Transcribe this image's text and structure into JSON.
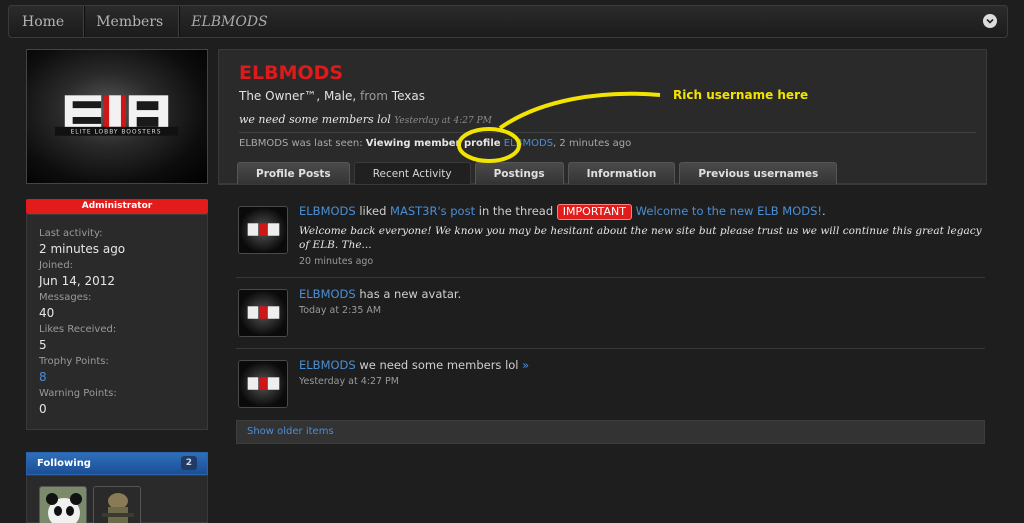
{
  "breadcrumb": {
    "items": [
      "Home",
      "Members",
      "ELBMODS"
    ]
  },
  "profile": {
    "username": "ELBMODS",
    "title_line": "The Owner™, Male,",
    "from_label": "from",
    "location": "Texas",
    "status": "we need some members lol",
    "status_time": "Yesterday at 4:27 PM",
    "last_seen_prefix": "ELBMODS was last seen:",
    "last_seen_action": "Viewing member profile",
    "last_seen_link": "ELBMODS",
    "last_seen_time": ", 2 minutes ago",
    "logo_text": "ELB",
    "logo_sub": "ELITE LOBBY BOOSTERS"
  },
  "sidebar": {
    "role": "Administrator",
    "stats": [
      {
        "label": "Last activity:",
        "value": "2 minutes ago"
      },
      {
        "label": "Joined:",
        "value": "Jun 14, 2012"
      },
      {
        "label": "Messages:",
        "value": "40"
      },
      {
        "label": "Likes Received:",
        "value": "5"
      },
      {
        "label": "Trophy Points:",
        "value": "8"
      },
      {
        "label": "Warning Points:",
        "value": "0"
      }
    ],
    "following_label": "Following",
    "following_count": "2"
  },
  "tabs": [
    "Profile Posts",
    "Recent Activity",
    "Postings",
    "Information",
    "Previous usernames"
  ],
  "activity": [
    {
      "user": "ELBMODS",
      "verb": "liked",
      "target": "MAST3R's post",
      "middle": "in the thread",
      "prefix_badge": "IMPORTANT",
      "thread": "Welcome to the new ELB MODS!",
      "end": ".",
      "excerpt": "Welcome back everyone! We know you may be hesitant about the new site but please trust us we will continue this great legacy of ELB. The...",
      "time": "20 minutes ago"
    },
    {
      "user": "ELBMODS",
      "verb": "has a new avatar.",
      "time": "Today at 2:35 AM"
    },
    {
      "user": "ELBMODS",
      "verb": "we need some members lol",
      "arrow": "»",
      "time": "Yesterday at 4:27 PM"
    }
  ],
  "show_older": "Show older items",
  "annotation": {
    "text": "Rich username here",
    "color": "#f2e400"
  },
  "colors": {
    "accent_red": "#e01a1a",
    "link_blue": "#4a8fd6",
    "following_blue": "#2f6ebb"
  }
}
